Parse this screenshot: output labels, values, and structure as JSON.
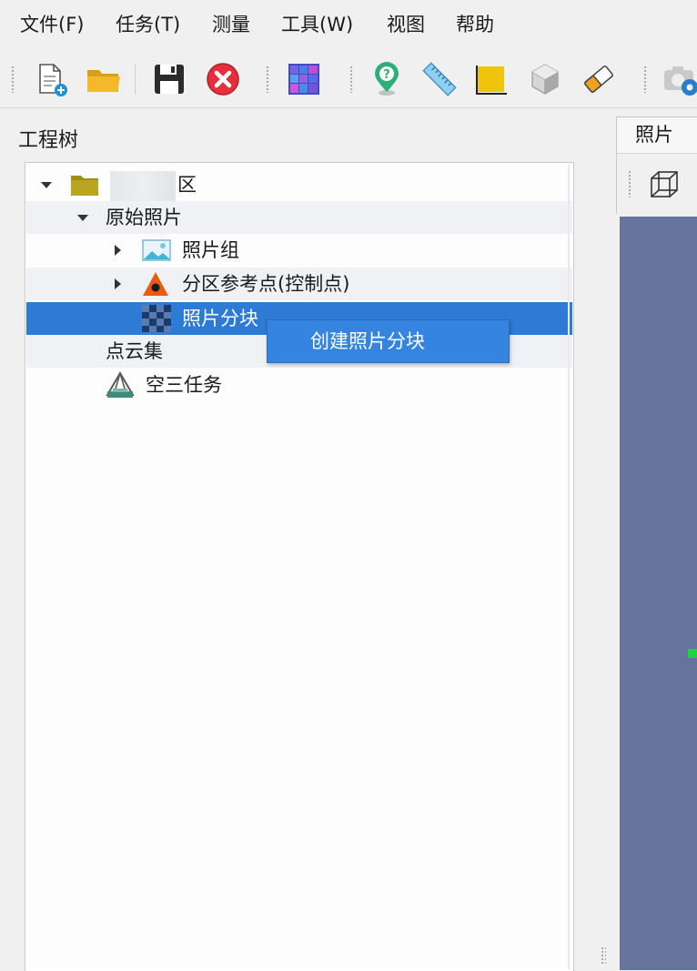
{
  "menu": [
    "文件(F)",
    "任务(T)",
    "测量",
    "工具(W)",
    "视图",
    "帮助"
  ],
  "toolbar": {
    "buttons": [
      {
        "icon": "new-project-icon"
      },
      {
        "icon": "open-folder-icon"
      },
      {
        "icon": "save-icon"
      },
      {
        "icon": "close-project-icon"
      },
      {
        "icon": "mosaic-grid-icon"
      },
      {
        "icon": "help-location-icon"
      },
      {
        "icon": "ruler-icon"
      },
      {
        "icon": "area-measure-icon"
      },
      {
        "icon": "volume-cube-icon"
      },
      {
        "icon": "eraser-icon"
      },
      {
        "icon": "camera-settings-icon"
      }
    ]
  },
  "panel": {
    "title": "工程树"
  },
  "tree": {
    "root_suffix": "区",
    "original_photos": "原始照片",
    "photo_group": "照片组",
    "partition_refpoints": "分区参考点(控制点)",
    "photo_blocks": "照片分块",
    "point_cloud_set": "点云集",
    "aerial_triangulation": "空三任务"
  },
  "context_menu": {
    "create_blocks": "创建照片分块"
  },
  "right_panel": {
    "tab_label": "照片"
  },
  "colors": {
    "selection": "#2e7bd6",
    "context_menu": "#3584e0",
    "viewport": "#66739d",
    "marker": "#19d63a"
  }
}
